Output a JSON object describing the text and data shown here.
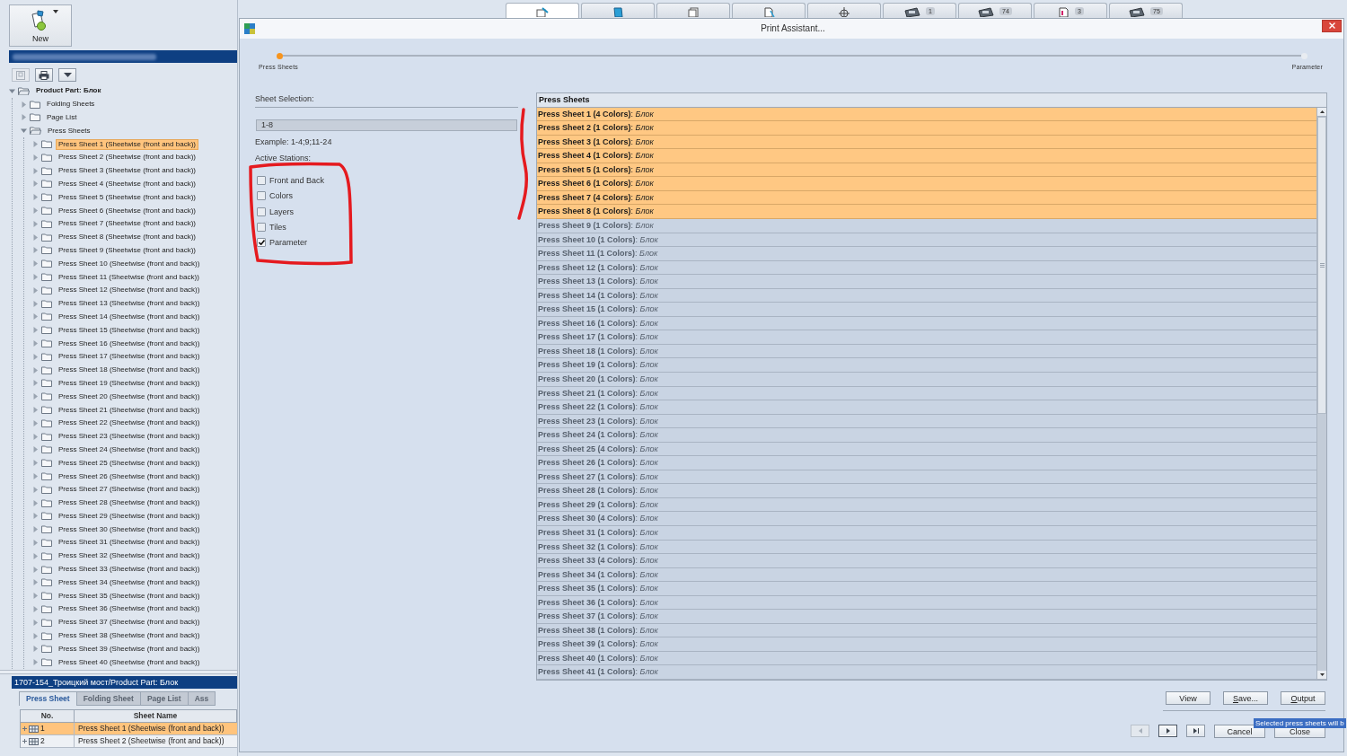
{
  "new_button": {
    "label": "New"
  },
  "mini_toolbar": [
    {
      "disabled": true
    },
    {
      "disabled": false
    },
    {
      "disabled": false
    }
  ],
  "tree": [
    {
      "label": "Product Part: Блок",
      "expanded": true,
      "selected": false,
      "children": [
        {
          "label": "Folding Sheets",
          "expanded": false,
          "selected": false
        },
        {
          "label": "Page List",
          "expanded": false,
          "selected": false
        },
        {
          "label": "Press Sheets",
          "expanded": true,
          "selected": false,
          "children": [
            {
              "label": "Press Sheet 1 (Sheetwise (front and back))",
              "expanded": false,
              "selected": true
            },
            {
              "label": "Press Sheet 2 (Sheetwise (front and back))",
              "expanded": false,
              "selected": false
            },
            {
              "label": "Press Sheet 3 (Sheetwise (front and back))",
              "expanded": false,
              "selected": false
            },
            {
              "label": "Press Sheet 4 (Sheetwise (front and back))",
              "expanded": false,
              "selected": false
            },
            {
              "label": "Press Sheet 5 (Sheetwise (front and back))",
              "expanded": false,
              "selected": false
            },
            {
              "label": "Press Sheet 6 (Sheetwise (front and back))",
              "expanded": false,
              "selected": false
            },
            {
              "label": "Press Sheet 7 (Sheetwise (front and back))",
              "expanded": false,
              "selected": false
            },
            {
              "label": "Press Sheet 8 (Sheetwise (front and back))",
              "expanded": false,
              "selected": false
            },
            {
              "label": "Press Sheet 9 (Sheetwise (front and back))",
              "expanded": false,
              "selected": false
            },
            {
              "label": "Press Sheet 10 (Sheetwise (front and back))",
              "expanded": false,
              "selected": false
            },
            {
              "label": "Press Sheet 11 (Sheetwise (front and back))",
              "expanded": false,
              "selected": false
            },
            {
              "label": "Press Sheet 12 (Sheetwise (front and back))",
              "expanded": false,
              "selected": false
            },
            {
              "label": "Press Sheet 13 (Sheetwise (front and back))",
              "expanded": false,
              "selected": false
            },
            {
              "label": "Press Sheet 14 (Sheetwise (front and back))",
              "expanded": false,
              "selected": false
            },
            {
              "label": "Press Sheet 15 (Sheetwise (front and back))",
              "expanded": false,
              "selected": false
            },
            {
              "label": "Press Sheet 16 (Sheetwise (front and back))",
              "expanded": false,
              "selected": false
            },
            {
              "label": "Press Sheet 17 (Sheetwise (front and back))",
              "expanded": false,
              "selected": false
            },
            {
              "label": "Press Sheet 18 (Sheetwise (front and back))",
              "expanded": false,
              "selected": false
            },
            {
              "label": "Press Sheet 19 (Sheetwise (front and back))",
              "expanded": false,
              "selected": false
            },
            {
              "label": "Press Sheet 20 (Sheetwise (front and back))",
              "expanded": false,
              "selected": false
            },
            {
              "label": "Press Sheet 21 (Sheetwise (front and back))",
              "expanded": false,
              "selected": false
            },
            {
              "label": "Press Sheet 22 (Sheetwise (front and back))",
              "expanded": false,
              "selected": false
            },
            {
              "label": "Press Sheet 23 (Sheetwise (front and back))",
              "expanded": false,
              "selected": false
            },
            {
              "label": "Press Sheet 24 (Sheetwise (front and back))",
              "expanded": false,
              "selected": false
            },
            {
              "label": "Press Sheet 25 (Sheetwise (front and back))",
              "expanded": false,
              "selected": false
            },
            {
              "label": "Press Sheet 26 (Sheetwise (front and back))",
              "expanded": false,
              "selected": false
            },
            {
              "label": "Press Sheet 27 (Sheetwise (front and back))",
              "expanded": false,
              "selected": false
            },
            {
              "label": "Press Sheet 28 (Sheetwise (front and back))",
              "expanded": false,
              "selected": false
            },
            {
              "label": "Press Sheet 29 (Sheetwise (front and back))",
              "expanded": false,
              "selected": false
            },
            {
              "label": "Press Sheet 30 (Sheetwise (front and back))",
              "expanded": false,
              "selected": false
            },
            {
              "label": "Press Sheet 31 (Sheetwise (front and back))",
              "expanded": false,
              "selected": false
            },
            {
              "label": "Press Sheet 32 (Sheetwise (front and back))",
              "expanded": false,
              "selected": false
            },
            {
              "label": "Press Sheet 33 (Sheetwise (front and back))",
              "expanded": false,
              "selected": false
            },
            {
              "label": "Press Sheet 34 (Sheetwise (front and back))",
              "expanded": false,
              "selected": false
            },
            {
              "label": "Press Sheet 35 (Sheetwise (front and back))",
              "expanded": false,
              "selected": false
            },
            {
              "label": "Press Sheet 36 (Sheetwise (front and back))",
              "expanded": false,
              "selected": false
            },
            {
              "label": "Press Sheet 37 (Sheetwise (front and back))",
              "expanded": false,
              "selected": false
            },
            {
              "label": "Press Sheet 38 (Sheetwise (front and back))",
              "expanded": false,
              "selected": false
            },
            {
              "label": "Press Sheet 39 (Sheetwise (front and back))",
              "expanded": false,
              "selected": false
            },
            {
              "label": "Press Sheet 40 (Sheetwise (front and back))",
              "expanded": false,
              "selected": false
            }
          ]
        }
      ]
    }
  ],
  "path_bar": "1707-154_Троицкий мост/Product Part: Блок",
  "bottom_tabs": [
    {
      "label": "Press Sheet",
      "selected": true
    },
    {
      "label": "Folding Sheet",
      "selected": false
    },
    {
      "label": "Page List",
      "selected": false
    },
    {
      "label": "Ass",
      "selected": false
    }
  ],
  "sheet_table": {
    "columns": [
      "No.",
      "Sheet Name"
    ],
    "rows": [
      {
        "no": "1",
        "name": "Press Sheet 1 (Sheetwise (front and back))",
        "selected": true
      },
      {
        "no": "2",
        "name": "Press Sheet 2 (Sheetwise (front and back))",
        "selected": false
      }
    ]
  },
  "top_tabs": [
    {
      "selected": true
    },
    {
      "selected": false
    },
    {
      "selected": false
    },
    {
      "selected": false
    },
    {
      "selected": false
    },
    {
      "selected": false,
      "badge": "1"
    },
    {
      "selected": false,
      "badge": "74"
    },
    {
      "selected": false,
      "badge": "3"
    },
    {
      "selected": false,
      "badge": "75"
    }
  ],
  "dialog": {
    "title": "Print Assistant...",
    "steps": [
      {
        "label": "Press Sheets",
        "selected": true
      },
      {
        "label": "Parameter",
        "selected": false
      }
    ],
    "sheet_selection": {
      "label": "Sheet Selection:",
      "value": "1-8",
      "example": "Example: 1-4;9;11-24"
    },
    "active_stations": {
      "label": "Active Stations:",
      "options": [
        {
          "label": "Front and Back",
          "checked": false
        },
        {
          "label": "Colors",
          "checked": false
        },
        {
          "label": "Layers",
          "checked": false
        },
        {
          "label": "Tiles",
          "checked": false
        },
        {
          "label": "Parameter",
          "checked": true
        }
      ]
    },
    "sheet_list": {
      "header": "Press Sheets",
      "rows": [
        {
          "text": "**Press Sheet 1 (4 Colors)**: *Блок*",
          "selected": true
        },
        {
          "text": "**Press Sheet 2 (1 Colors)**: *Блок*",
          "selected": true
        },
        {
          "text": "**Press Sheet 3 (1 Colors)**: *Блок*",
          "selected": true
        },
        {
          "text": "**Press Sheet 4 (1 Colors)**: *Блок*",
          "selected": true
        },
        {
          "text": "**Press Sheet 5 (1 Colors)**: *Блок*",
          "selected": true
        },
        {
          "text": "**Press Sheet 6 (1 Colors)**: *Блок*",
          "selected": true
        },
        {
          "text": "**Press Sheet 7 (4 Colors)**: *Блок*",
          "selected": true
        },
        {
          "text": "**Press Sheet 8 (1 Colors)**: *Блок*",
          "selected": true
        },
        {
          "text": "**Press Sheet 9 (1 Colors)**: *Блок*",
          "selected": false
        },
        {
          "text": "**Press Sheet 10 (1 Colors)**: *Блок*",
          "selected": false
        },
        {
          "text": "**Press Sheet 11 (1 Colors)**: *Блок*",
          "selected": false
        },
        {
          "text": "**Press Sheet 12 (1 Colors)**: *Блок*",
          "selected": false
        },
        {
          "text": "**Press Sheet 13 (1 Colors)**: *Блок*",
          "selected": false
        },
        {
          "text": "**Press Sheet 14 (1 Colors)**: *Блок*",
          "selected": false
        },
        {
          "text": "**Press Sheet 15 (1 Colors)**: *Блок*",
          "selected": false
        },
        {
          "text": "**Press Sheet 16 (1 Colors)**: *Блок*",
          "selected": false
        },
        {
          "text": "**Press Sheet 17 (1 Colors)**: *Блок*",
          "selected": false
        },
        {
          "text": "**Press Sheet 18 (1 Colors)**: *Блок*",
          "selected": false
        },
        {
          "text": "**Press Sheet 19 (1 Colors)**: *Блок*",
          "selected": false
        },
        {
          "text": "**Press Sheet 20 (1 Colors)**: *Блок*",
          "selected": false
        },
        {
          "text": "**Press Sheet 21 (1 Colors)**: *Блок*",
          "selected": false
        },
        {
          "text": "**Press Sheet 22 (1 Colors)**: *Блок*",
          "selected": false
        },
        {
          "text": "**Press Sheet 23 (1 Colors)**: *Блок*",
          "selected": false
        },
        {
          "text": "**Press Sheet 24 (1 Colors)**: *Блок*",
          "selected": false
        },
        {
          "text": "**Press Sheet 25 (4 Colors)**: *Блок*",
          "selected": false
        },
        {
          "text": "**Press Sheet 26 (1 Colors)**: *Блок*",
          "selected": false
        },
        {
          "text": "**Press Sheet 27 (1 Colors)**: *Блок*",
          "selected": false
        },
        {
          "text": "**Press Sheet 28 (1 Colors)**: *Блок*",
          "selected": false
        },
        {
          "text": "**Press Sheet 29 (1 Colors)**: *Блок*",
          "selected": false
        },
        {
          "text": "**Press Sheet 30 (4 Colors)**: *Блок*",
          "selected": false
        },
        {
          "text": "**Press Sheet 31 (1 Colors)**: *Блок*",
          "selected": false
        },
        {
          "text": "**Press Sheet 32 (1 Colors)**: *Блок*",
          "selected": false
        },
        {
          "text": "**Press Sheet 33 (4 Colors)**: *Блок*",
          "selected": false
        },
        {
          "text": "**Press Sheet 34 (1 Colors)**: *Блок*",
          "selected": false
        },
        {
          "text": "**Press Sheet 35 (1 Colors)**: *Блок*",
          "selected": false
        },
        {
          "text": "**Press Sheet 36 (1 Colors)**: *Блок*",
          "selected": false
        },
        {
          "text": "**Press Sheet 37 (1 Colors)**: *Блок*",
          "selected": false
        },
        {
          "text": "**Press Sheet 38 (1 Colors)**: *Блок*",
          "selected": false
        },
        {
          "text": "**Press Sheet 39 (1 Colors)**: *Блок*",
          "selected": false
        },
        {
          "text": "**Press Sheet 40 (1 Colors)**: *Блок*",
          "selected": false
        },
        {
          "text": "**Press Sheet 41 (1 Colors)**: *Блок*",
          "selected": false
        }
      ]
    },
    "action_buttons": [
      {
        "label": "View",
        "mnemonic": false
      },
      {
        "label": "Save...",
        "mnemonic": true
      },
      {
        "label": "Output",
        "mnemonic": true
      }
    ],
    "nav_buttons": [
      {
        "kind": "previous",
        "disabled": true,
        "focused": false
      },
      {
        "kind": "next",
        "disabled": false,
        "focused": true
      },
      {
        "kind": "last",
        "disabled": false,
        "focused": false
      }
    ],
    "footer_buttons": [
      {
        "label": "Cancel"
      },
      {
        "label": "Close"
      }
    ],
    "tooltip": "Selected press sheets will b"
  }
}
